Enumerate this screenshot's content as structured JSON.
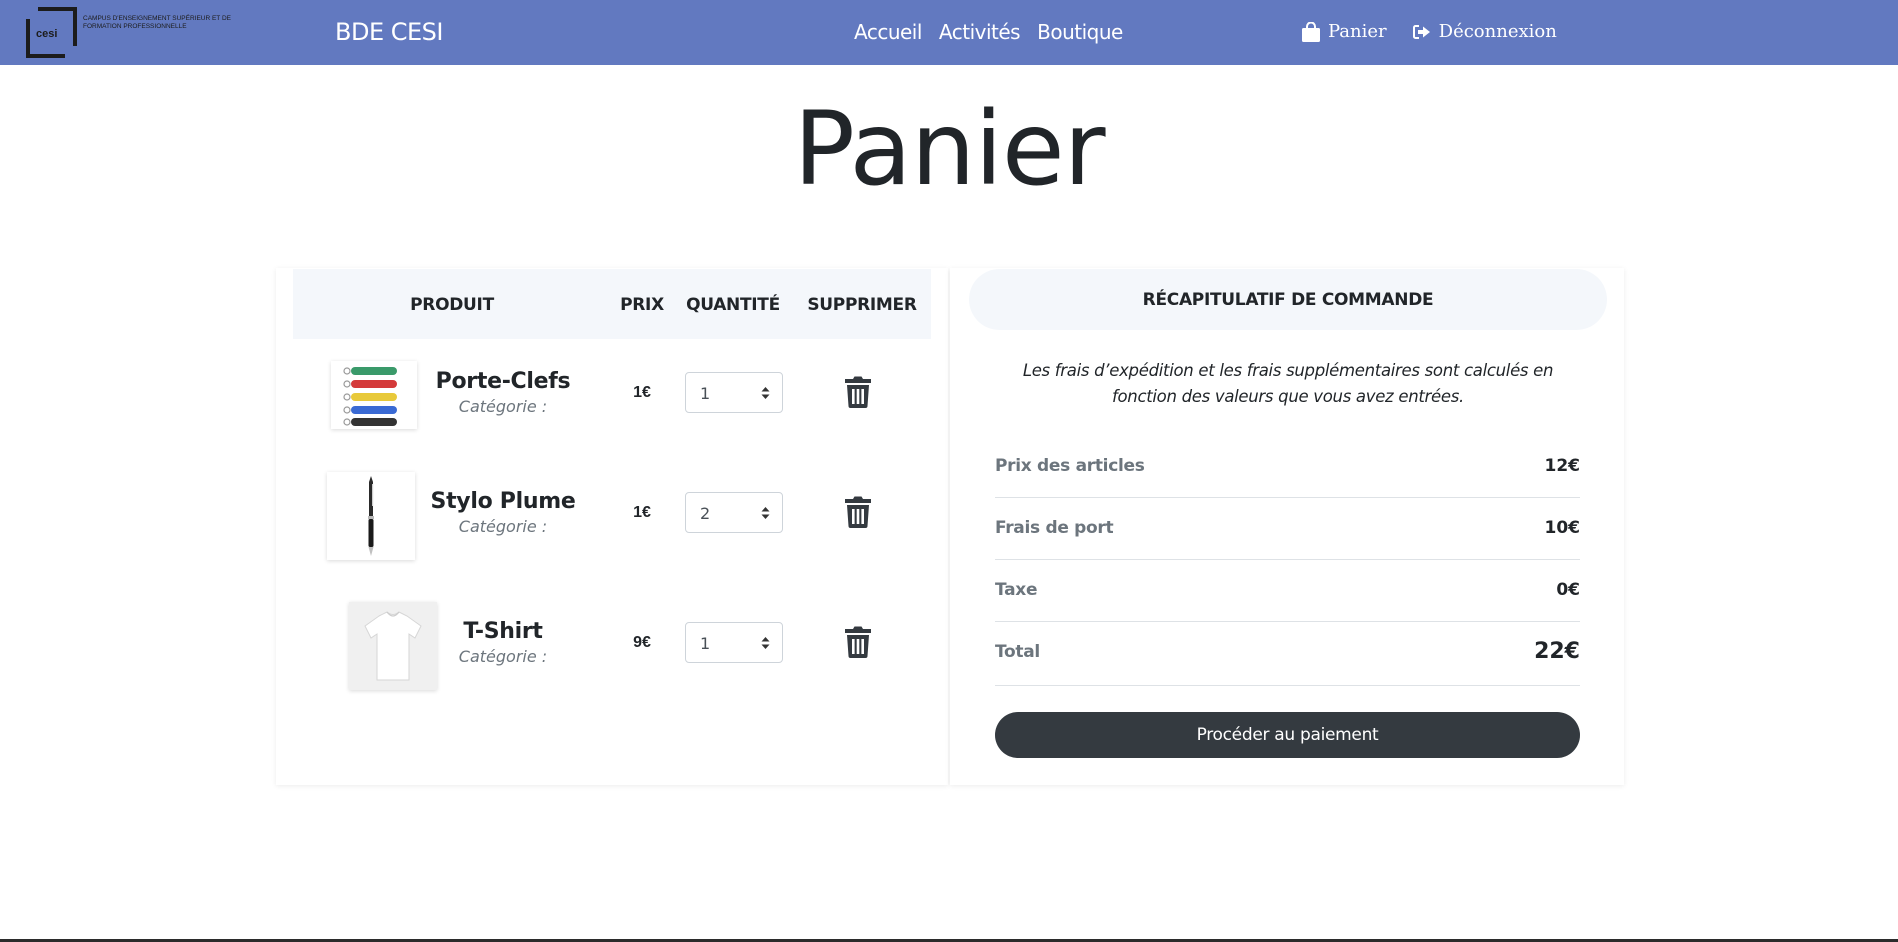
{
  "navbar": {
    "logo": {
      "word": "cesi",
      "tagline": "Campus d'enseignement supérieur et de formation professionnelle"
    },
    "brand": "BDE CESI",
    "links": [
      "Accueil",
      "Activités",
      "Boutique"
    ],
    "cart_label": "Panier",
    "logout_label": "Déconnexion",
    "background_color": "#6279c0"
  },
  "page_title": "Panier",
  "cart": {
    "headers": {
      "product": "Produit",
      "price": "Prix",
      "quantity": "Quantité",
      "delete": "Supprimer"
    },
    "items": [
      {
        "name": "Porte-Clefs",
        "category": "Catégorie :",
        "price": "1€",
        "quantity": "1",
        "image": "keychain-tags"
      },
      {
        "name": "Stylo Plume",
        "category": "Catégorie :",
        "price": "1€",
        "quantity": "2",
        "image": "fountain-pen"
      },
      {
        "name": "T-Shirt",
        "category": "Catégorie :",
        "price": "9€",
        "quantity": "1",
        "image": "white-tshirt"
      }
    ]
  },
  "summary": {
    "title": "Récapitulatif de commande",
    "note": "Les frais d’expédition et les frais supplémentaires sont calculés en fonction des valeurs que vous avez entrées.",
    "rows": [
      {
        "label": "Prix des articles",
        "value": "12€"
      },
      {
        "label": "Frais de port",
        "value": "10€"
      },
      {
        "label": "Taxe",
        "value": "0€"
      },
      {
        "label": "Total",
        "value": "22€"
      }
    ],
    "pay_button": "Procéder au paiement",
    "button_color": "#343a40"
  }
}
